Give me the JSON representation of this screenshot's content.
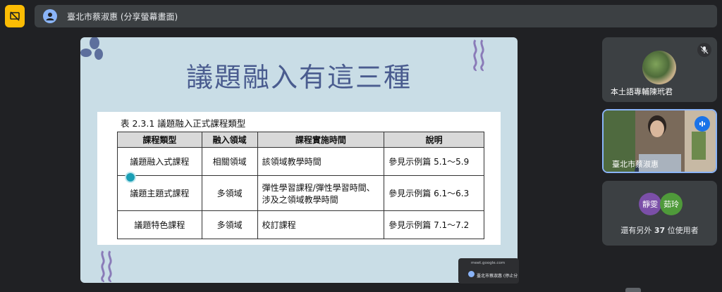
{
  "presenter": {
    "name": "臺北市蔡淑惠 (分享螢幕畫面)"
  },
  "slide": {
    "title": "議題融入有這三種",
    "table_caption": "表 2.3.1 議題融入正式課程類型",
    "headers": [
      "課程類型",
      "融入領域",
      "課程實施時間",
      "說明"
    ],
    "rows": [
      [
        "議題融入式課程",
        "相關領域",
        "該領域教學時間",
        "參見示例篇 5.1～5.9"
      ],
      [
        "議題主題式課程",
        "多領域",
        "彈性學習課程/彈性學習時間、涉及之領域教學時間",
        "參見示例篇 6.1～6.3"
      ],
      [
        "議題特色課程",
        "多領域",
        "校訂課程",
        "參見示例篇 7.1～7.2"
      ]
    ]
  },
  "mini_preview": {
    "url": "meet.google.com",
    "name": "臺北市蔡淑惠 (停止分"
  },
  "participants": [
    {
      "name": "本土語專輔陳玳君",
      "mic": "muted"
    },
    {
      "name": "臺北市蔡淑惠",
      "mic": "speaking"
    }
  ],
  "others": {
    "avatars": [
      {
        "label": "靜雯",
        "color": "#7b4fa8"
      },
      {
        "label": "茹玲",
        "color": "#4f9a3a"
      }
    ],
    "prefix": "還有另外",
    "count": "37",
    "suffix": "位使用者"
  },
  "icons": {
    "stop_share": "stop-presenting-icon",
    "presenter_avatar": "account-icon",
    "mic_off": "mic-off-icon",
    "speaking": "speaking-icon"
  },
  "colors": {
    "background": "#202124",
    "stop_share": "#fbbc04",
    "slide_bg": "#c9dde6",
    "title": "#4a5c8f",
    "speaking": "#1a73e8"
  }
}
